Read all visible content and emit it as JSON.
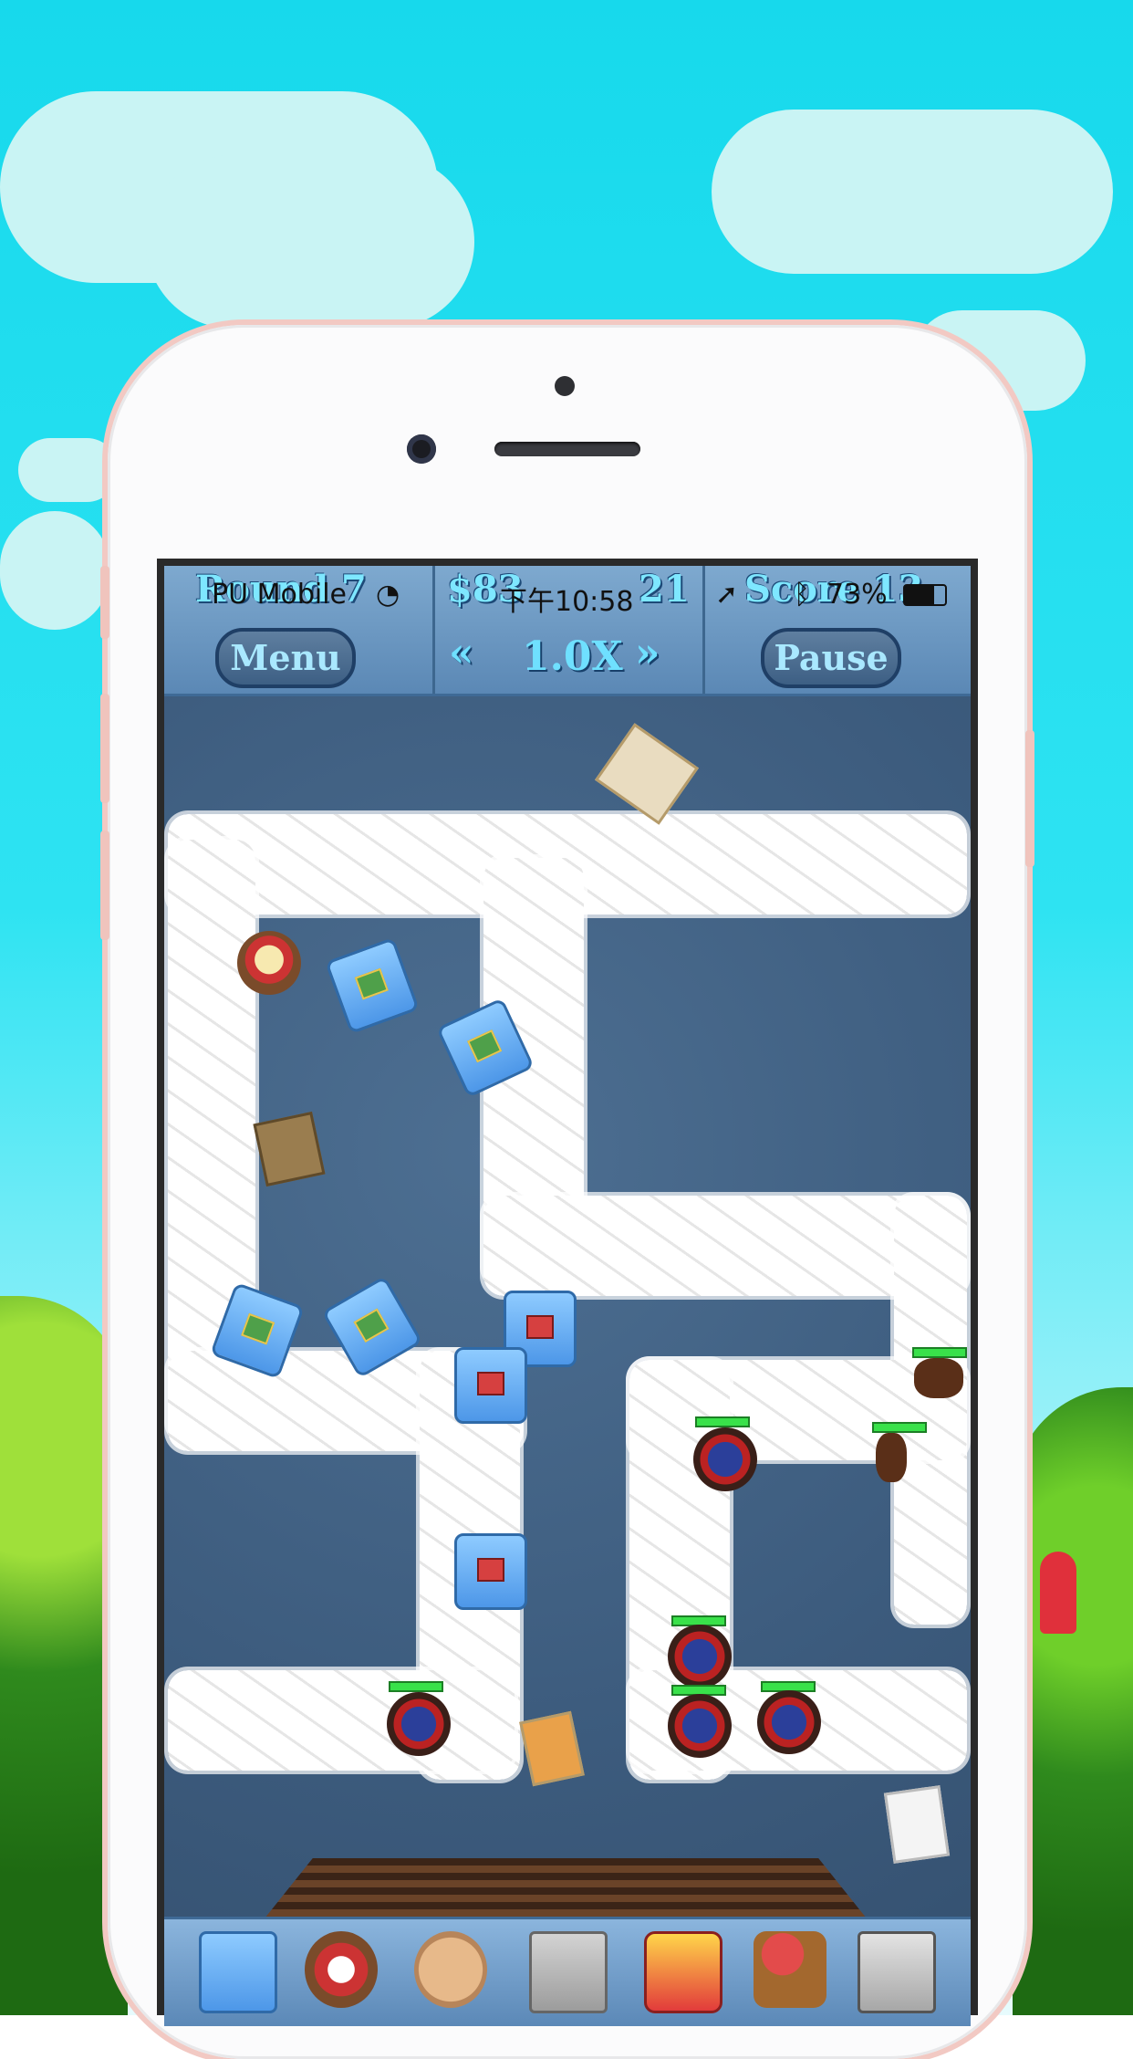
{
  "colors": {
    "sky": "#17d9ec",
    "phone_frame": "#f2c9c3",
    "hud_text": "#7ee7ff",
    "carpet": "#3c5b7d",
    "health_bar": "#39e14a"
  },
  "status_bar": {
    "carrier": "PU Mobile",
    "time": "下午10:58",
    "battery": "73%"
  },
  "hud": {
    "round_label": "Round 7",
    "money_label": "$83",
    "lives_label": "21",
    "score_label": "Score 13",
    "menu_label": "Menu",
    "speed_label": "1.0X",
    "pause_label": "Pause"
  },
  "shop": {
    "items": [
      {
        "name": "blue-cabinet-tower-icon"
      },
      {
        "name": "robot-tower-icon"
      },
      {
        "name": "cookie-tower-icon"
      },
      {
        "name": "gray-box-tower-icon"
      },
      {
        "name": "red-car-tower-icon"
      },
      {
        "name": "pizza-cart-tower-icon"
      },
      {
        "name": "oven-tower-icon"
      }
    ]
  }
}
